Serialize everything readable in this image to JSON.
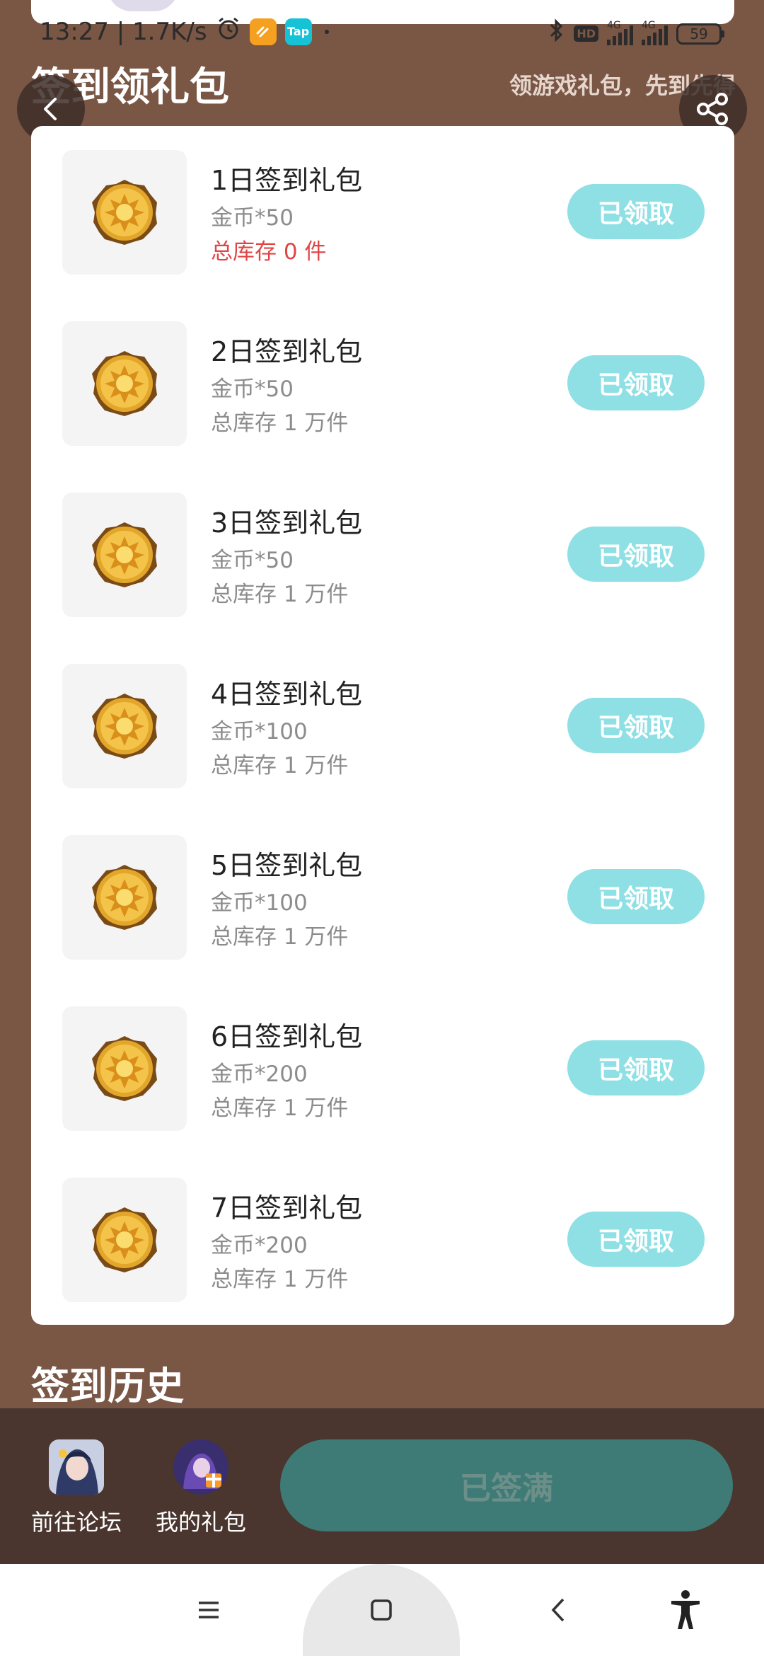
{
  "status_bar": {
    "time_speed": "13:27 | 1.7K/s",
    "tap_label": "Tap",
    "hd_label": "HD",
    "net1": "4G",
    "net2": "4G",
    "battery": "59"
  },
  "header": {
    "title": "签到领礼包",
    "subtitle": "领游戏礼包，先到先得"
  },
  "gifts": [
    {
      "title": "1日签到礼包",
      "reward": "金币*50",
      "stock": "总库存 0 件",
      "button": "已领取"
    },
    {
      "title": "2日签到礼包",
      "reward": "金币*50",
      "stock": "总库存 1 万件",
      "button": "已领取"
    },
    {
      "title": "3日签到礼包",
      "reward": "金币*50",
      "stock": "总库存 1 万件",
      "button": "已领取"
    },
    {
      "title": "4日签到礼包",
      "reward": "金币*100",
      "stock": "总库存 1 万件",
      "button": "已领取"
    },
    {
      "title": "5日签到礼包",
      "reward": "金币*100",
      "stock": "总库存 1 万件",
      "button": "已领取"
    },
    {
      "title": "6日签到礼包",
      "reward": "金币*200",
      "stock": "总库存 1 万件",
      "button": "已领取"
    },
    {
      "title": "7日签到礼包",
      "reward": "金币*200",
      "stock": "总库存 1 万件",
      "button": "已领取"
    }
  ],
  "history": {
    "title": "签到历史"
  },
  "bottom": {
    "forum_label": "前往论坛",
    "my_gifts_label": "我的礼包",
    "sign_button": "已签满"
  },
  "colors": {
    "background": "#7a5645",
    "claim_button": "#8ee0e5",
    "sign_button": "#3f7b76",
    "stock_empty": "#e04545"
  }
}
